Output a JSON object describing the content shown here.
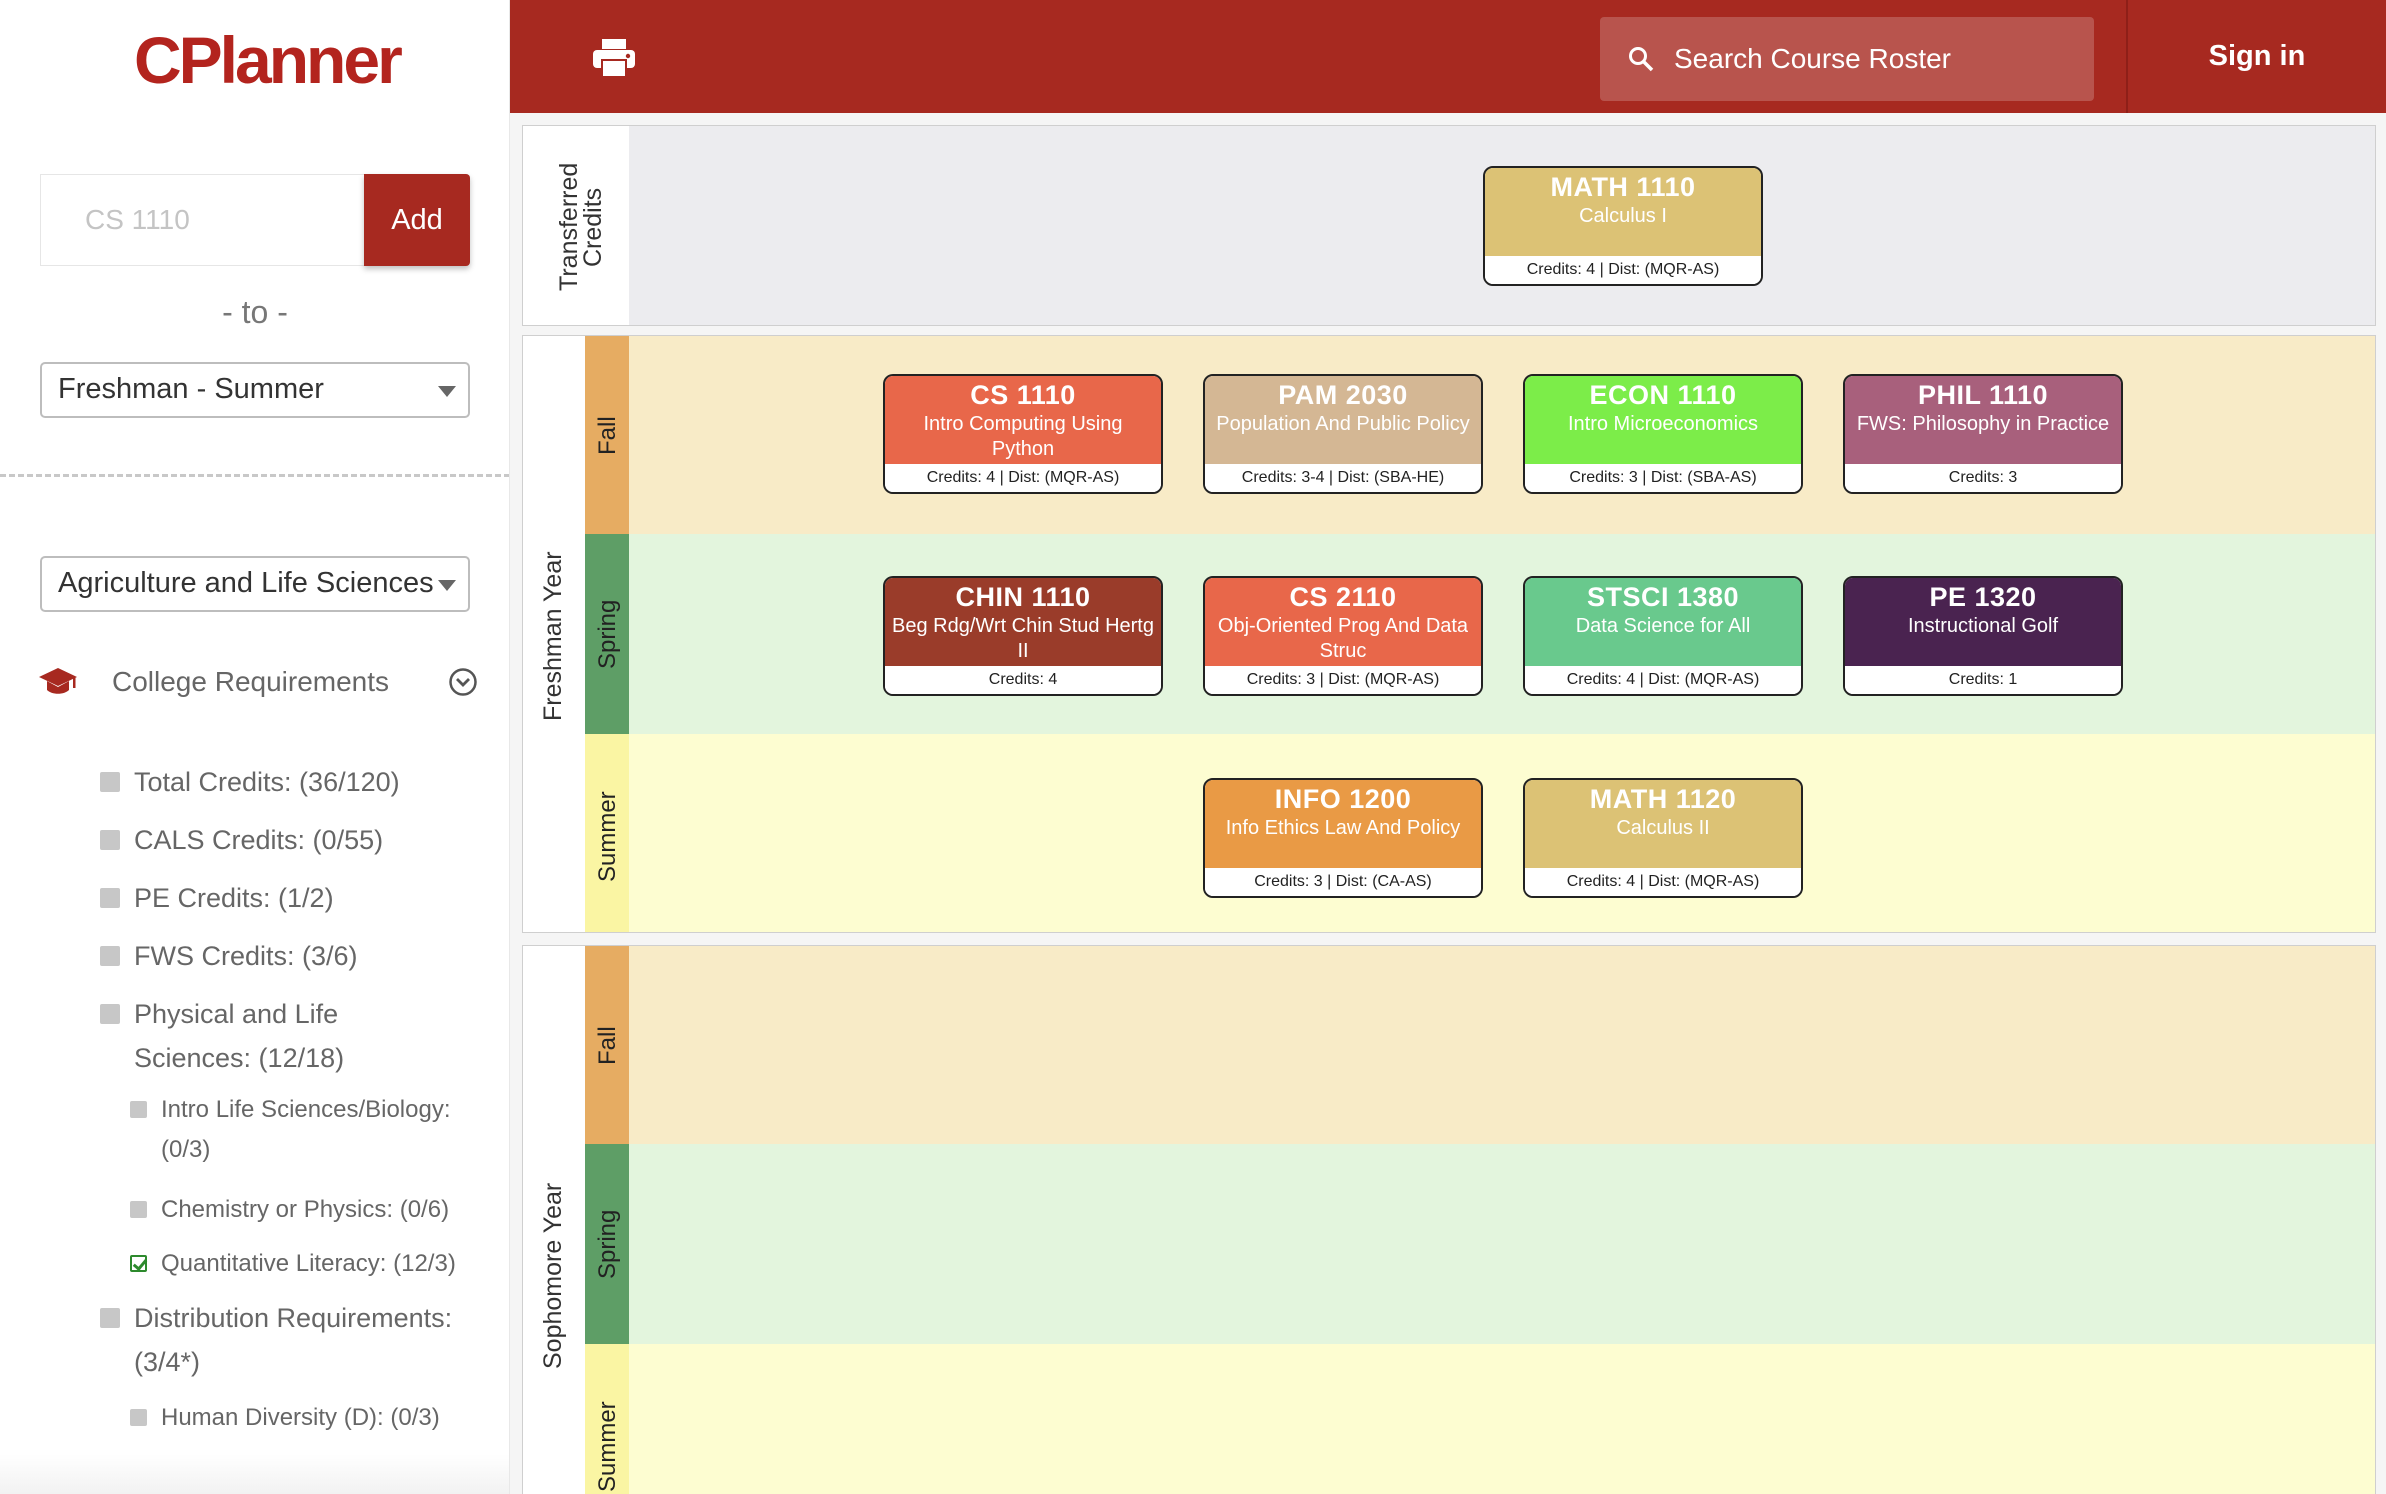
{
  "app": {
    "logo": "CPlanner"
  },
  "topbar": {
    "search_placeholder": "Search Course Roster",
    "signin_label": "Sign in",
    "print_icon": "print-icon",
    "search_icon": "search-icon"
  },
  "sidebar": {
    "course_input_placeholder": "CS 1110",
    "add_label": "Add",
    "to_label": "- to -",
    "semester_select": "Freshman - Summer",
    "college_select": "Agriculture and Life Sciences",
    "requirements_header": "College Requirements",
    "requirements": [
      {
        "label": "Total Credits: (36/120)",
        "checked": false
      },
      {
        "label": "CALS Credits: (0/55)",
        "checked": false
      },
      {
        "label": "PE Credits: (1/2)",
        "checked": false
      },
      {
        "label": "FWS Credits: (3/6)",
        "checked": false
      },
      {
        "label": "Physical and Life Sciences: (12/18)",
        "checked": false
      },
      {
        "label": "Intro Life Sciences/Biology: (0/3)",
        "checked": false
      },
      {
        "label": "Chemistry or Physics: (0/6)",
        "checked": false
      },
      {
        "label": "Quantitative Literacy: (12/3)",
        "checked": true
      },
      {
        "label": "Distribution Requirements: (3/4*)",
        "checked": false
      },
      {
        "label": "Human Diversity (D): (0/3)",
        "checked": false
      }
    ]
  },
  "colors": {
    "brand": "#a72920",
    "fall_tab": "#e6ac62",
    "spring_tab": "#5e9e66",
    "summer_tab": "#faf5a3"
  },
  "planner": {
    "transfer_label": "Transferred Credits",
    "transfer_courses": [
      {
        "code": "MATH 1110",
        "name": "Calculus I",
        "info": "Credits: 4 | Dist: (MQR-AS)",
        "color": "#dcc275"
      }
    ],
    "years": [
      {
        "label": "Freshman Year",
        "semesters": [
          {
            "label": "Fall",
            "courses": [
              {
                "code": "CS 1110",
                "name": "Intro Computing Using Python",
                "info": "Credits: 4 | Dist: (MQR-AS)",
                "color": "#e8674a"
              },
              {
                "code": "PAM 2030",
                "name": "Population And Public Policy",
                "info": "Credits: 3-4 | Dist: (SBA-HE)",
                "color": "#d4b794"
              },
              {
                "code": "ECON 1110",
                "name": "Intro Microeconomics",
                "info": "Credits: 3 | Dist: (SBA-AS)",
                "color": "#7ced49"
              },
              {
                "code": "PHIL 1110",
                "name": "FWS: Philosophy in Practice",
                "info": "Credits: 3",
                "color": "#a8607c"
              }
            ]
          },
          {
            "label": "Spring",
            "courses": [
              {
                "code": "CHIN 1110",
                "name": "Beg Rdg/Wrt Chin Stud Hertg II",
                "info": "Credits: 4",
                "color": "#9a3c2a"
              },
              {
                "code": "CS 2110",
                "name": "Obj-Oriented Prog And Data Struc",
                "info": "Credits: 3 | Dist: (MQR-AS)",
                "color": "#e8674a"
              },
              {
                "code": "STSCI 1380",
                "name": "Data Science for All",
                "info": "Credits: 4 | Dist: (MQR-AS)",
                "color": "#69c98d"
              },
              {
                "code": "PE 1320",
                "name": "Instructional Golf",
                "info": "Credits: 1",
                "color": "#4a2350"
              }
            ]
          },
          {
            "label": "Summer",
            "courses": [
              {
                "code": "INFO 1200",
                "name": "Info Ethics Law And Policy",
                "info": "Credits: 3 | Dist: (CA-AS)",
                "color": "#e99a45"
              },
              {
                "code": "MATH 1120",
                "name": "Calculus II",
                "info": "Credits: 4 | Dist: (MQR-AS)",
                "color": "#dcc275"
              }
            ]
          }
        ]
      },
      {
        "label": "Sophomore Year",
        "semesters": [
          {
            "label": "Fall",
            "courses": []
          },
          {
            "label": "Spring",
            "courses": []
          },
          {
            "label": "Summer",
            "courses": []
          }
        ]
      }
    ]
  }
}
